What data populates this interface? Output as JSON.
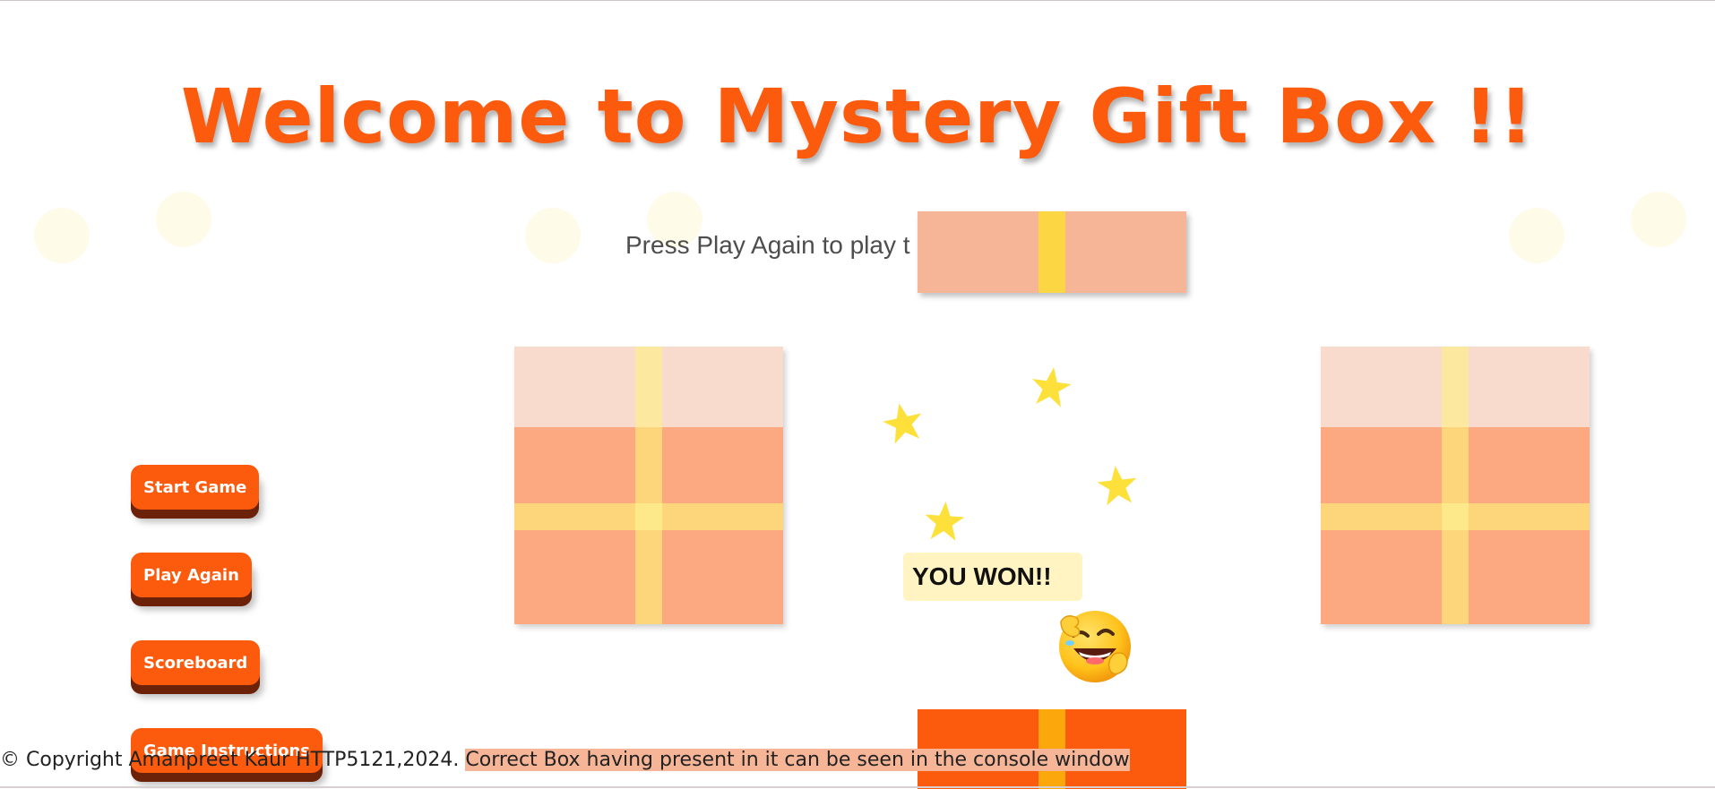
{
  "title": "Welcome to Mystery Gift Box !!",
  "subtitle": "Press Play Again to play t",
  "result_text": "YOU WON!!",
  "buttons": {
    "start": "Start Game",
    "play_again": "Play Again",
    "scoreboard": "Scoreboard",
    "instructions": "Game Instructions"
  },
  "footer": {
    "copyright": "© Copyright Amanpreet Kaur HTTP5121,2024.",
    "hint": "Correct Box having present in it can be seen in the console window"
  },
  "icons": {
    "star": "star-icon",
    "emoji": "laughing-face-emoji-icon"
  },
  "colors": {
    "accent": "#fc5a0d",
    "button_shadow": "#6b2209",
    "box": "#fca881",
    "box_lid": "#f8dbcd",
    "ribbon": "#fdd57b",
    "star": "#fde03a",
    "result_bg": "#fff4c2"
  }
}
